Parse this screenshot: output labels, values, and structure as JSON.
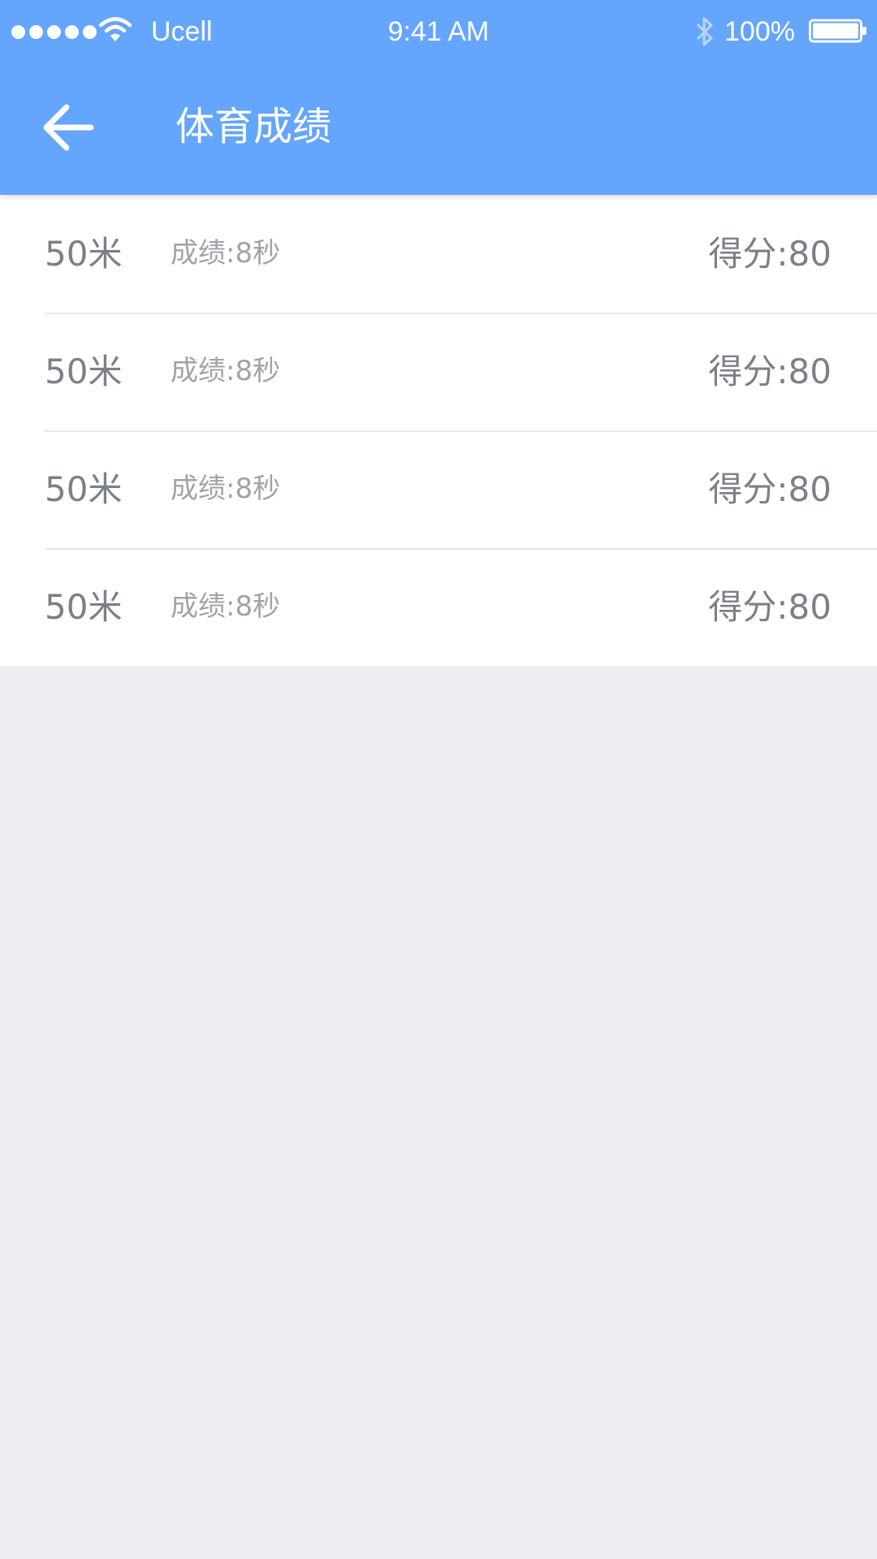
{
  "status_bar": {
    "carrier": "Ucell",
    "time": "9:41 AM",
    "battery": "100%",
    "signal_bars": 5
  },
  "nav": {
    "title": "体育成绩",
    "back_icon": "arrow-left-icon"
  },
  "colors": {
    "header": "#64a5fe",
    "background": "#edeef2",
    "primary_text": "#7b8088",
    "secondary_text": "#a0a3a8"
  },
  "records": [
    {
      "event": "50米",
      "result": "成绩:8秒",
      "score": "得分:80"
    },
    {
      "event": "50米",
      "result": "成绩:8秒",
      "score": "得分:80"
    },
    {
      "event": "50米",
      "result": "成绩:8秒",
      "score": "得分:80"
    },
    {
      "event": "50米",
      "result": "成绩:8秒",
      "score": "得分:80"
    }
  ]
}
